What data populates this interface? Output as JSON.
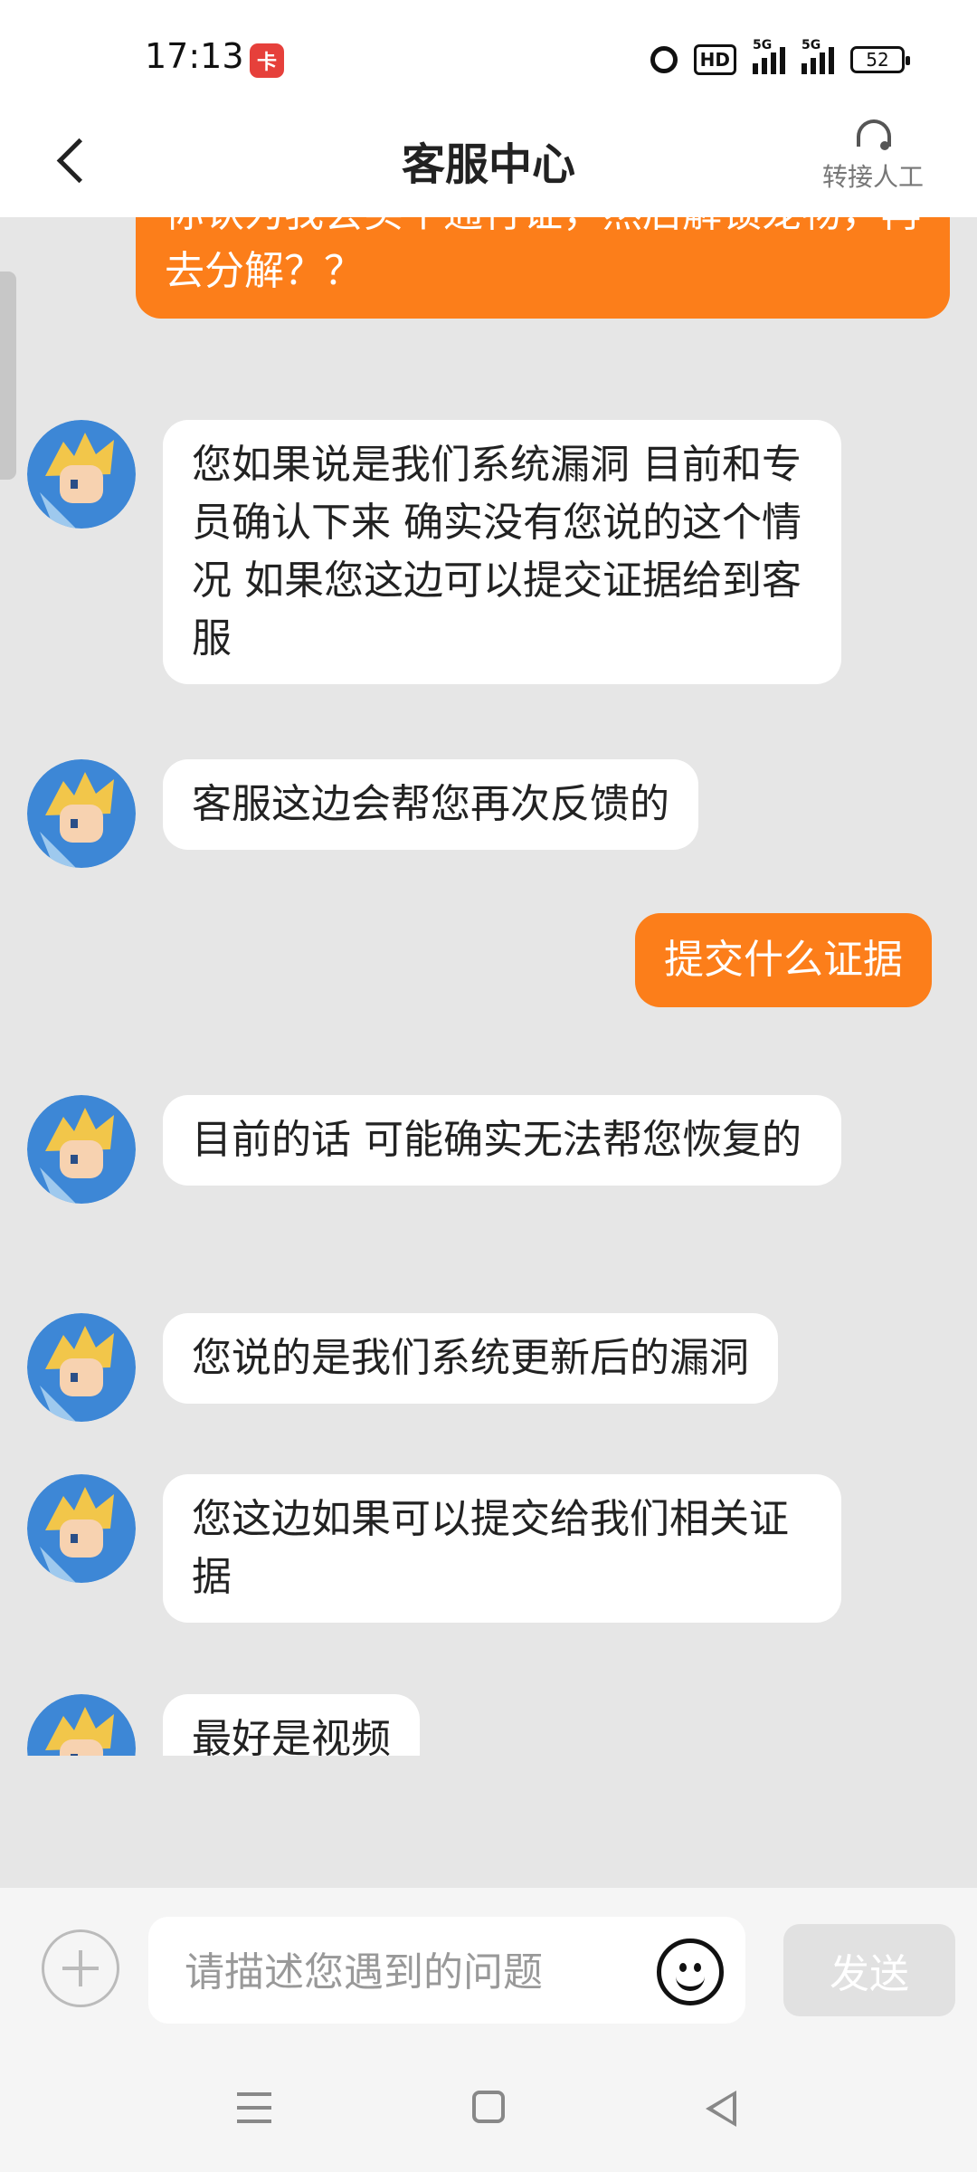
{
  "status_bar": {
    "time": "17:13",
    "app_badge": "卡",
    "network": "HD",
    "signal_1": "5G",
    "signal_2": "5G",
    "battery": "52"
  },
  "header": {
    "title": "客服中心",
    "transfer_label": "转接人工"
  },
  "messages": [
    {
      "sender": "user",
      "text": "你认为我会买个通行证，然后解锁宠物，再去分解？？"
    },
    {
      "sender": "agent",
      "text": "您如果说是我们系统漏洞  目前和专员确认下来  确实没有您说的这个情况   如果您这边可以提交证据给到客服"
    },
    {
      "sender": "agent",
      "text": "客服这边会帮您再次反馈的"
    },
    {
      "sender": "user",
      "text": "提交什么证据"
    },
    {
      "sender": "agent",
      "text": "目前的话  可能确实无法帮您恢复的"
    },
    {
      "sender": "agent",
      "text": "您说的是我们系统更新后的漏洞"
    },
    {
      "sender": "agent",
      "text": "您这边如果可以提交给我们相关证据"
    },
    {
      "sender": "agent",
      "text": "最好是视频"
    }
  ],
  "input": {
    "placeholder": "请描述您遇到的问题",
    "send_label": "发送"
  },
  "icons": {
    "back": "chevron-left-icon",
    "transfer": "headset-icon",
    "plus": "plus-icon",
    "emoji": "smiley-icon"
  },
  "colors": {
    "user_bubble": "#fc7e1a",
    "agent_bubble": "#ffffff",
    "chat_bg": "#e6e6e6"
  }
}
